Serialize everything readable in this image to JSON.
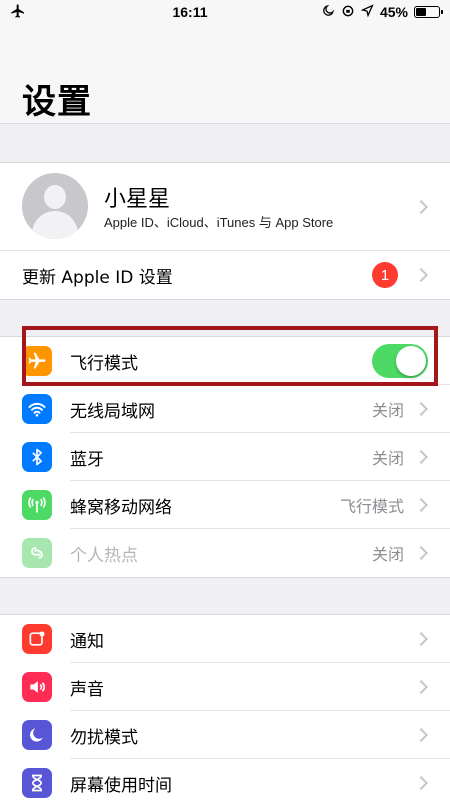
{
  "status_bar": {
    "time": "16:11",
    "battery_percent": "45%",
    "battery_level": 0.45,
    "icons": [
      "airplane-icon",
      "moon-icon",
      "rotation-lock-icon",
      "location-icon",
      "battery-icon"
    ]
  },
  "header": {
    "title": "设置"
  },
  "profile": {
    "name": "小星星",
    "subtitle": "Apple ID、iCloud、iTunes 与 App Store"
  },
  "update_row": {
    "label": "更新 Apple ID 设置",
    "badge": "1"
  },
  "connectivity": [
    {
      "label": "飞行模式",
      "value": "",
      "icon": "airplane-icon",
      "color": "#ff9500",
      "toggle_on": true
    },
    {
      "label": "无线局域网",
      "value": "关闭",
      "icon": "wifi-icon",
      "color": "#007aff"
    },
    {
      "label": "蓝牙",
      "value": "关闭",
      "icon": "bluetooth-icon",
      "color": "#007aff"
    },
    {
      "label": "蜂窝移动网络",
      "value": "飞行模式",
      "icon": "cellular-icon",
      "color": "#4cd964"
    },
    {
      "label": "个人热点",
      "value": "关闭",
      "icon": "hotspot-icon",
      "color": "#a8e6b0"
    }
  ],
  "general": [
    {
      "label": "通知",
      "icon": "notifications-icon",
      "color": "#ff3b30"
    },
    {
      "label": "声音",
      "icon": "sound-icon",
      "color": "#ff2d55"
    },
    {
      "label": "勿扰模式",
      "icon": "moon-icon",
      "color": "#5856d6"
    },
    {
      "label": "屏幕使用时间",
      "icon": "hourglass-icon",
      "color": "#5856d6"
    }
  ],
  "highlight_color": "#a4161a"
}
